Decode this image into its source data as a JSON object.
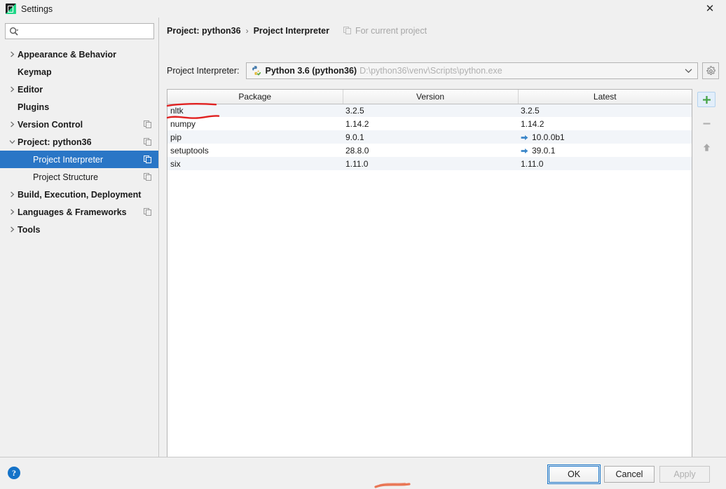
{
  "window": {
    "title": "Settings",
    "icon": "pycharm-icon",
    "close_label": "✕"
  },
  "sidebar": {
    "search": {
      "placeholder": "",
      "value": "",
      "icon": "search-icon"
    },
    "items": [
      {
        "label": "Appearance & Behavior",
        "expandable": true,
        "expanded": false,
        "bold": true,
        "indent": false,
        "copy_icon": false,
        "selected": false
      },
      {
        "label": "Keymap",
        "expandable": false,
        "expanded": false,
        "bold": true,
        "indent": false,
        "copy_icon": false,
        "selected": false
      },
      {
        "label": "Editor",
        "expandable": true,
        "expanded": false,
        "bold": true,
        "indent": false,
        "copy_icon": false,
        "selected": false
      },
      {
        "label": "Plugins",
        "expandable": false,
        "expanded": false,
        "bold": true,
        "indent": false,
        "copy_icon": false,
        "selected": false
      },
      {
        "label": "Version Control",
        "expandable": true,
        "expanded": false,
        "bold": true,
        "indent": false,
        "copy_icon": true,
        "selected": false
      },
      {
        "label": "Project: python36",
        "expandable": true,
        "expanded": true,
        "bold": true,
        "indent": false,
        "copy_icon": true,
        "selected": false
      },
      {
        "label": "Project Interpreter",
        "expandable": false,
        "expanded": false,
        "bold": false,
        "indent": true,
        "copy_icon": true,
        "selected": true
      },
      {
        "label": "Project Structure",
        "expandable": false,
        "expanded": false,
        "bold": false,
        "indent": true,
        "copy_icon": true,
        "selected": false
      },
      {
        "label": "Build, Execution, Deployment",
        "expandable": true,
        "expanded": false,
        "bold": true,
        "indent": false,
        "copy_icon": false,
        "selected": false
      },
      {
        "label": "Languages & Frameworks",
        "expandable": true,
        "expanded": false,
        "bold": true,
        "indent": false,
        "copy_icon": true,
        "selected": false
      },
      {
        "label": "Tools",
        "expandable": true,
        "expanded": false,
        "bold": true,
        "indent": false,
        "copy_icon": false,
        "selected": false
      }
    ]
  },
  "content": {
    "breadcrumb": {
      "parent": "Project: python36",
      "separator": "›",
      "current": "Project Interpreter",
      "note": "For current project",
      "note_icon": "copy-icon"
    },
    "interpreter": {
      "label": "Project Interpreter:",
      "icon": "python-venv-icon",
      "name": "Python 3.6 (python36)",
      "path": "D:\\python36\\venv\\Scripts\\python.exe",
      "dropdown_icon": "chevron-down-icon",
      "settings_icon": "gear-icon"
    },
    "packages": {
      "columns": [
        "Package",
        "Version",
        "Latest"
      ],
      "rows": [
        {
          "package": "nltk",
          "version": "3.2.5",
          "latest": "3.2.5",
          "upgradable": false
        },
        {
          "package": "numpy",
          "version": "1.14.2",
          "latest": "1.14.2",
          "upgradable": false
        },
        {
          "package": "pip",
          "version": "9.0.1",
          "latest": "10.0.0b1",
          "upgradable": true
        },
        {
          "package": "setuptools",
          "version": "28.8.0",
          "latest": "39.0.1",
          "upgradable": true
        },
        {
          "package": "six",
          "version": "1.11.0",
          "latest": "1.11.0",
          "upgradable": false
        }
      ]
    },
    "toolbar": {
      "add_label": "+",
      "add_icon": "plus-icon",
      "remove_label": "−",
      "remove_icon": "minus-icon",
      "upgrade_icon": "arrow-up-icon"
    }
  },
  "footer": {
    "help_label": "?",
    "help_icon": "help-icon",
    "ok_label": "OK",
    "cancel_label": "Cancel",
    "apply_label": "Apply"
  },
  "annotations": {
    "accent_color": "#e02020",
    "marks": [
      {
        "name": "underline-nltk",
        "type": "straight-underline"
      },
      {
        "name": "underline-numpy",
        "type": "wavy-underline"
      },
      {
        "name": "bottom-edge-mark",
        "type": "partial-stroke"
      }
    ]
  },
  "colors": {
    "selection_blue": "#2a76c6",
    "window_bg": "#f0f0f0",
    "table_stripe": "#f2f5f9",
    "upgrade_arrow": "#3b87c9",
    "add_green": "#47a447",
    "help_blue": "#1573c8"
  }
}
